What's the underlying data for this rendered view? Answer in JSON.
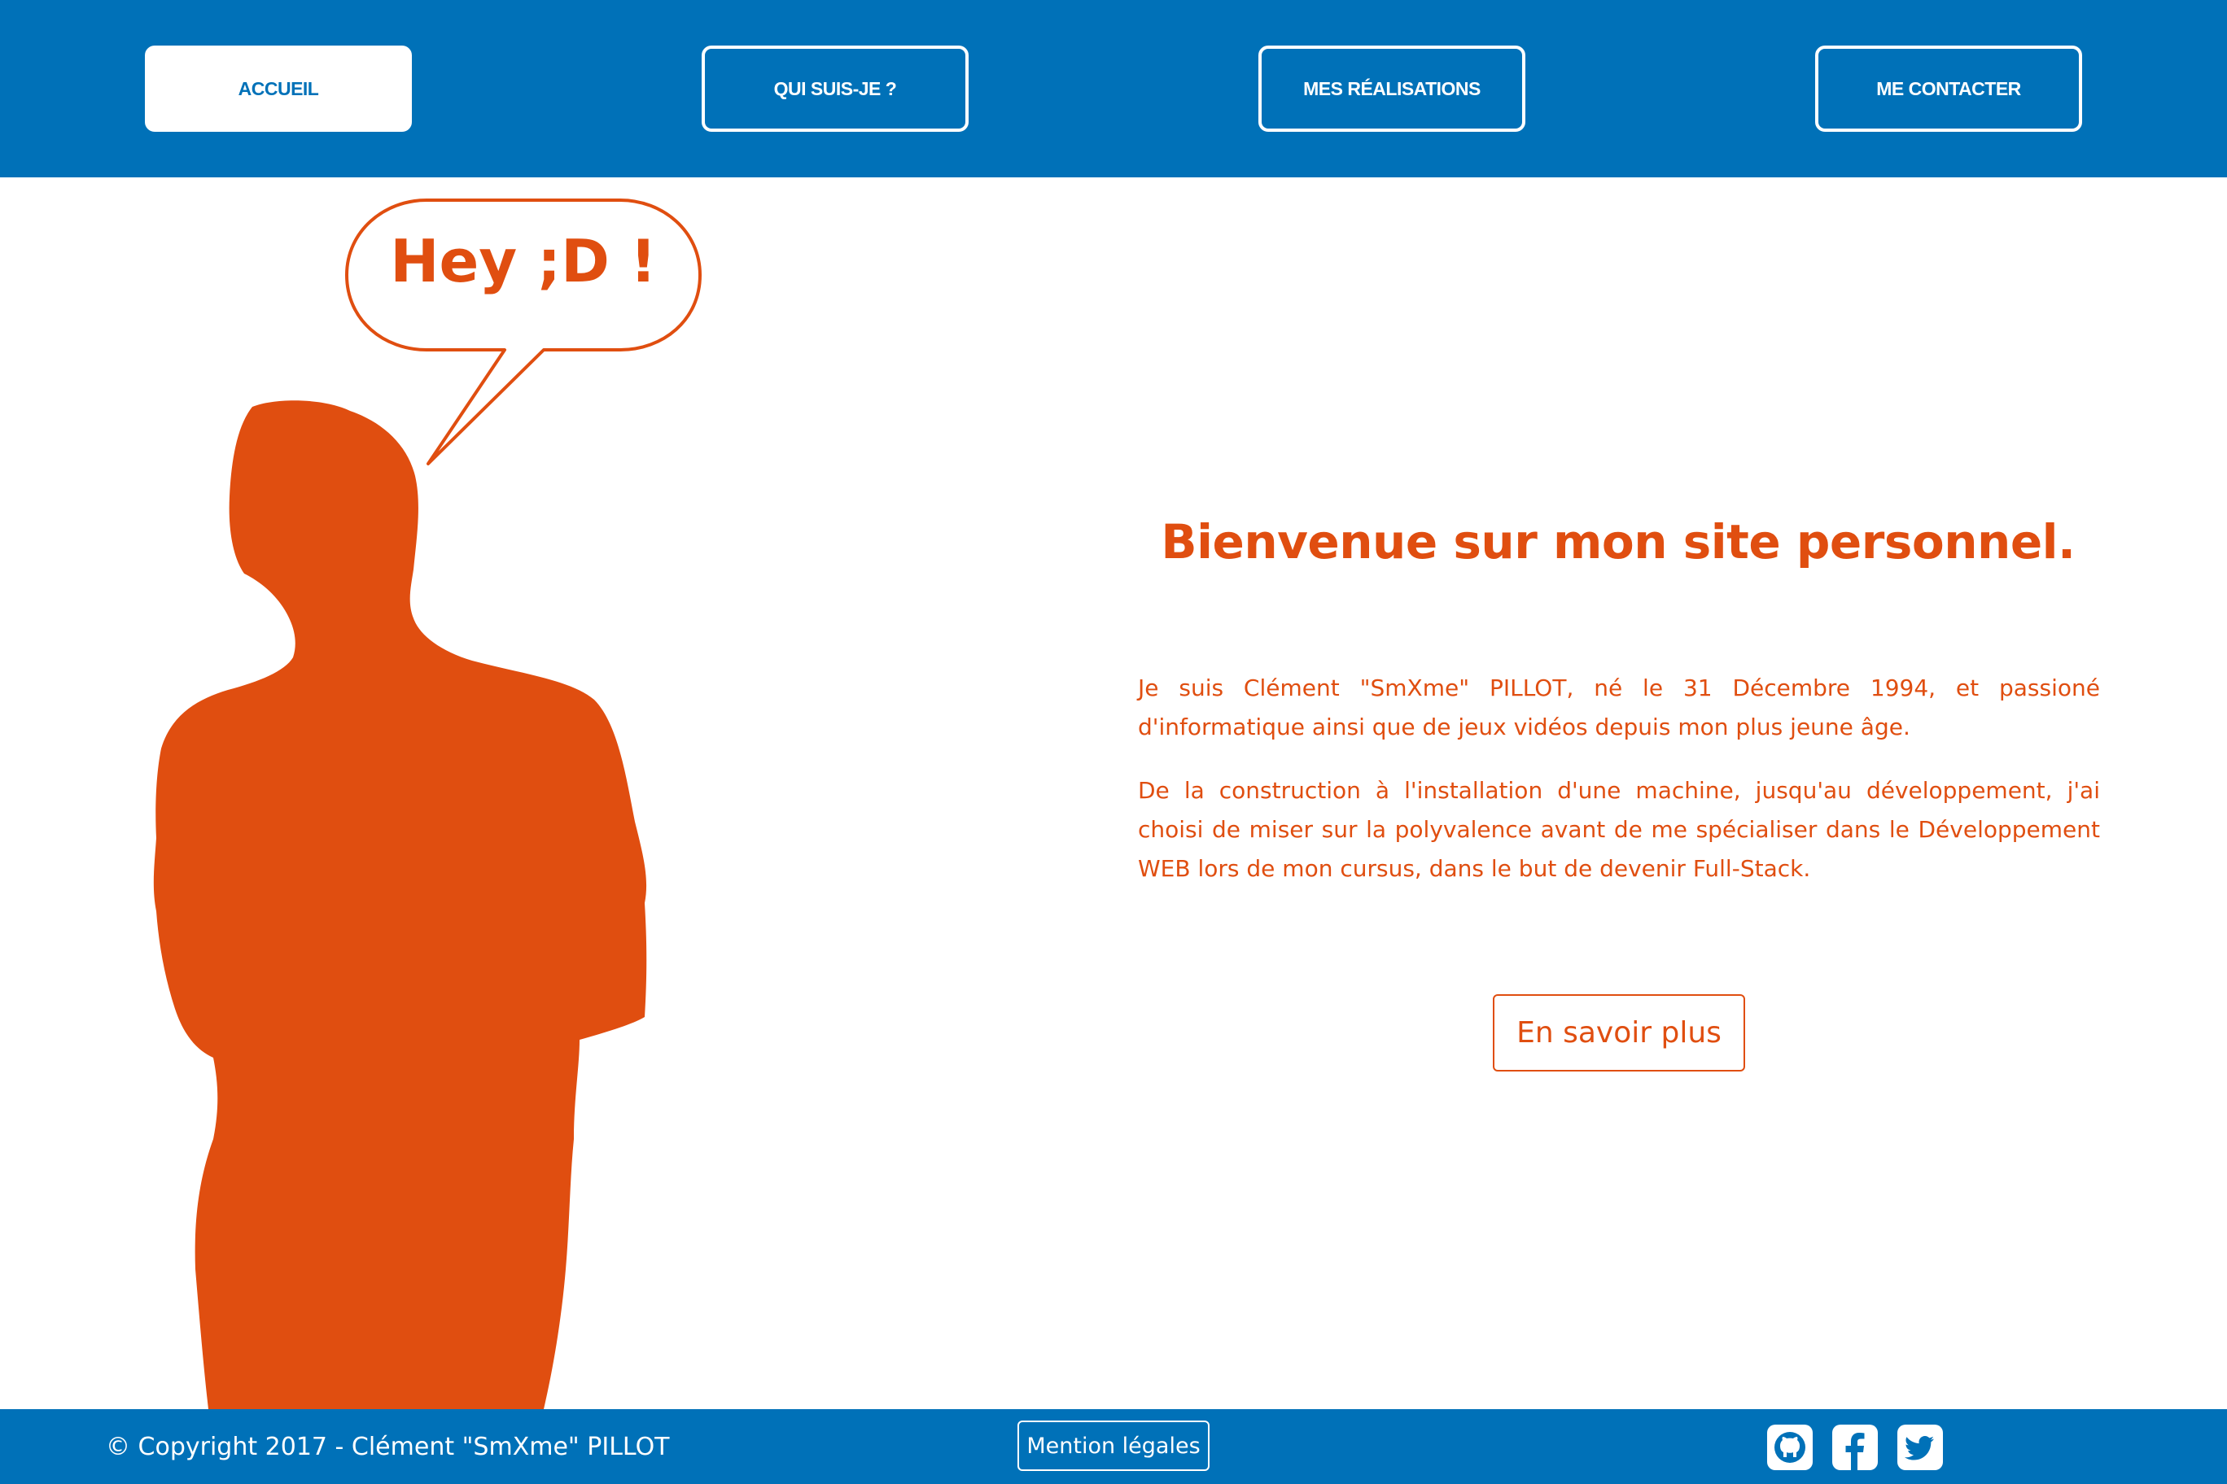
{
  "nav": {
    "items": [
      {
        "label": "ACCUEIL",
        "active": true
      },
      {
        "label": "QUI SUIS-JE ?",
        "active": false
      },
      {
        "label": "MES RÉALISATIONS",
        "active": false
      },
      {
        "label": "ME CONTACTER",
        "active": false
      }
    ]
  },
  "hero": {
    "speech": "Hey ;D !",
    "title": "Bienvenue sur mon site personnel.",
    "paragraphs": [
      "Je suis Clément \"SmXme\" PILLOT, né le 31 Décembre 1994, et passioné d'informatique ainsi que de jeux vidéos depuis mon plus jeune âge.",
      "De la construction à l'installation d'une machine, jusqu'au développement, j'ai choisi de miser sur la polyvalence avant de me spécialiser dans le Développement WEB lors de mon cursus, dans le but de devenir Full-Stack."
    ],
    "cta_label": "En savoir plus"
  },
  "footer": {
    "copyright": "© Copyright 2017 - Clément \"SmXme\" PILLOT",
    "legal_label": "Mention légales",
    "social": [
      "github-icon",
      "facebook-icon",
      "twitter-icon"
    ]
  },
  "colors": {
    "brand_blue": "#0071b8",
    "accent_orange": "#e04e10",
    "background": "#ffffff"
  }
}
